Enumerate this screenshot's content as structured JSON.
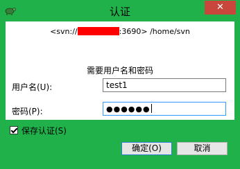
{
  "window": {
    "title": "认证",
    "close_label": "✕"
  },
  "url": {
    "prefix": "<svn://",
    "suffix": ":3690> /home/svn"
  },
  "prompt": "需要用户名和密码",
  "username": {
    "label": "用户名(U):",
    "value": "test1"
  },
  "password": {
    "label": "密码(P):",
    "masked_value": "●●●●●●"
  },
  "save_auth": {
    "label": "保存认证(S)",
    "checked": true
  },
  "buttons": {
    "ok": "确定(O)",
    "cancel": "取消"
  },
  "colors": {
    "window_frame": "#21b14b",
    "close_button": "#c9463d",
    "redaction": "#ff0000"
  }
}
